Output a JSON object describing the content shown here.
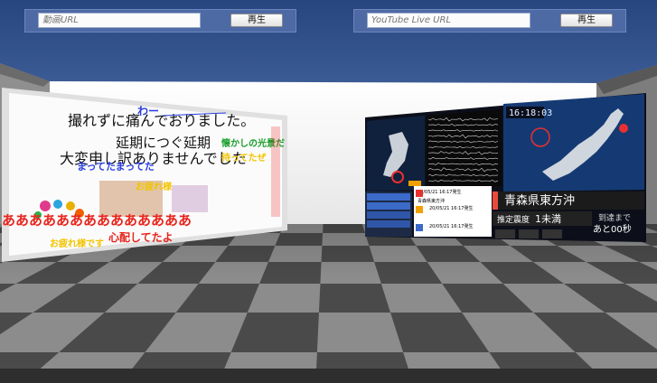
{
  "left_player": {
    "url_placeholder": "動画URL",
    "play_label": "再生"
  },
  "right_player": {
    "url_placeholder": "YouTube Live URL",
    "play_label": "再生"
  },
  "left_screen": {
    "comments": [
      "撮れずに痛んでおりました。",
      "延期につぐ延期",
      "大変申し訳ありませんでした",
      "まってたまってた",
      "わー",
      "懐かしの光景だ",
      "待ってたぜ",
      "お疲れ様",
      "お疲れ様です",
      "ああああああああああああああ",
      "心配してたよ"
    ]
  },
  "right_screen": {
    "clock": "16:18:03",
    "location": "青森県東方沖",
    "intensity_label": "推定震度",
    "intensity_value": "1未満",
    "arrival_label": "到達まで",
    "arrival_value": "あと00秒",
    "alert_1": "20/05/21 16:17発生",
    "alert_2": "20/05/21 16:17発生",
    "alert_3": "20/05/21 16:17発生",
    "region_short": "青森県東方沖"
  },
  "colors": {
    "sky": "#2f4e8a",
    "floor_light": "#8c8c8c",
    "floor_dark": "#4a4a4a",
    "wall": "#f2f2f2",
    "comment_red": "#e8241c",
    "comment_yellow": "#f2c500",
    "comment_green": "#1a9e2a",
    "comment_blue": "#2a3ee0"
  }
}
